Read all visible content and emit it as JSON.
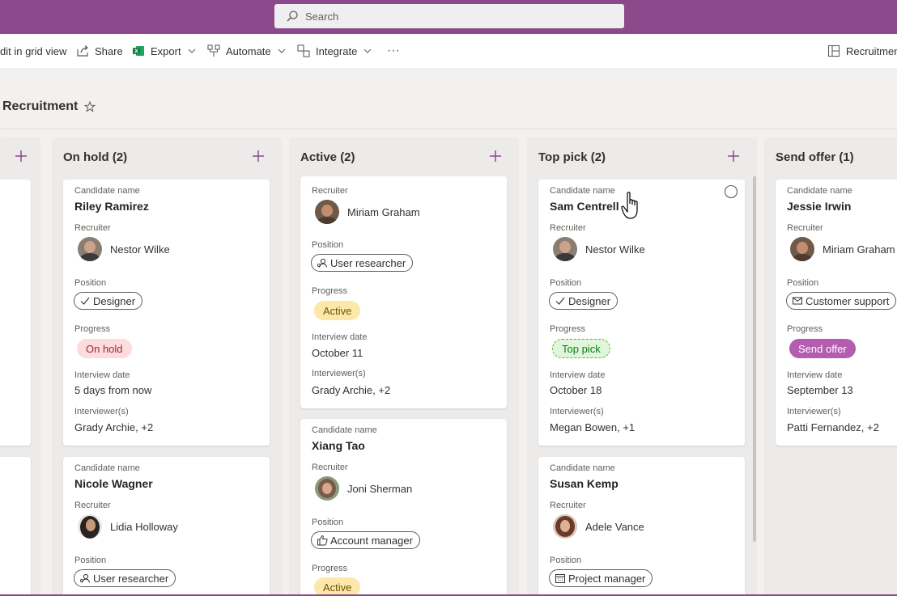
{
  "search": {
    "label": "Search"
  },
  "commands": {
    "grid": "dit in grid view",
    "share": "Share",
    "export": "Export",
    "automate": "Automate",
    "integrate": "Integrate",
    "more": "···",
    "view": "Recruitmen"
  },
  "page": {
    "title": "Recruitment"
  },
  "labels": {
    "candidate": "Candidate name",
    "recruiter": "Recruiter",
    "position": "Position",
    "progress": "Progress",
    "interview_date": "Interview date",
    "interviewers": "Interviewer(s)"
  },
  "columns": [
    {
      "title": "On hold (2)"
    },
    {
      "title": "Active (2)"
    },
    {
      "title": "Top pick (2)"
    },
    {
      "title": "Send offer (1)"
    }
  ],
  "cards": {
    "onhold1": {
      "name": "Riley Ramirez",
      "recruiter": "Nestor Wilke",
      "position": "Designer",
      "progress": "On hold",
      "date": "5 days from now",
      "interviewers": "Grady Archie, +2"
    },
    "onhold2": {
      "name": "Nicole Wagner",
      "recruiter": "Lidia Holloway",
      "position": "User researcher"
    },
    "active1": {
      "recruiter": "Miriam Graham",
      "position": "User researcher",
      "progress": "Active",
      "date": "October 11",
      "interviewers": "Grady Archie, +2"
    },
    "active2": {
      "name": "Xiang Tao",
      "recruiter": "Joni Sherman",
      "position": "Account manager",
      "progress": "Active"
    },
    "top1": {
      "name": "Sam Centrell",
      "recruiter": "Nestor Wilke",
      "position": "Designer",
      "progress": "Top pick",
      "date": "October 18",
      "interviewers": "Megan Bowen, +1"
    },
    "top2": {
      "name": "Susan Kemp",
      "recruiter": "Adele Vance",
      "position": "Project manager"
    },
    "offer1": {
      "name": "Jessie Irwin",
      "recruiter": "Miriam Graham",
      "position": "Customer support",
      "progress": "Send offer",
      "date": "September 13",
      "interviewers": "Patti Fernandez, +2"
    }
  },
  "colors": {
    "brand": "#8b4a8c",
    "on_hold": "#fcdcdc",
    "active": "#fde8a9",
    "top_pick": "#dff6dd",
    "send_offer": "#b35cb0"
  }
}
